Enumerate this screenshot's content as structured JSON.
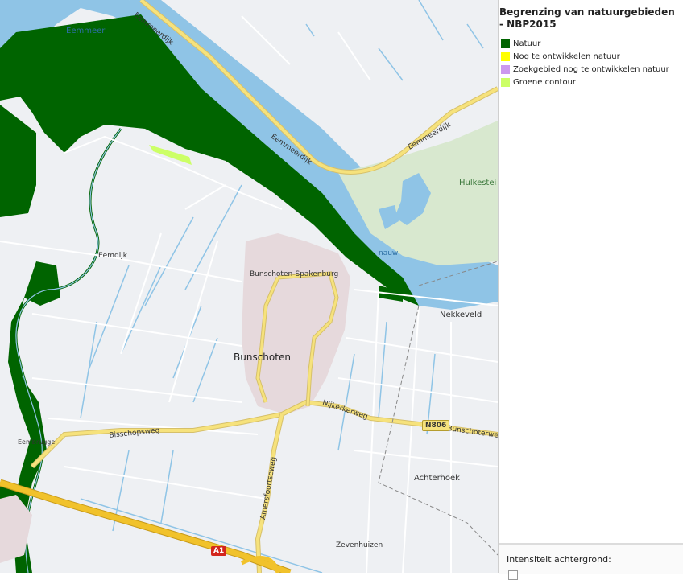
{
  "map": {
    "place_labels": {
      "eemmeer": "Eemmeer",
      "eemmeerdijk_1": "Eemmeerdijk",
      "eemmeerdijk_2": "Eemmeerdijk",
      "eemmeerdijk_3": "Eemmeerdijk",
      "hulkestein": "Hulkestei",
      "nauw": "nauw",
      "nekkeveld": "Nekkeveld",
      "bunschoten_spakenburg": "Bunschoten-Spakenburg",
      "bunschoten": "Bunschoten",
      "eemdijk": "Eemdijk",
      "nijkerkerweg": "Nijkerkerweg",
      "bunschoterweg": "Bunschoterwe",
      "bisschopsweg": "Bisschopsweg",
      "eembrugge": "Eembrugge",
      "amersfoortseweg": "Amersfoortseweg",
      "achterhoek": "Achterhoek",
      "zevenhuizen": "Zevenhuizen"
    },
    "shields": {
      "n806": "N806",
      "a1": "A1"
    },
    "colors": {
      "natuur": "#006400",
      "water": "#8fc4e6",
      "land": "#eef0f3",
      "urban": "#e6d9dc",
      "park": "#d8e8cf",
      "main_road": "#f6e27c",
      "motorway": "#f1c22b"
    }
  },
  "legend": {
    "title": "Begrenzing van natuurgebieden - NBP2015",
    "items": [
      {
        "label": "Natuur",
        "color": "#006400"
      },
      {
        "label": "Nog te ontwikkelen natuur",
        "color": "#ffff00"
      },
      {
        "label": "Zoekgebied nog te ontwikkelen natuur",
        "color": "#cc99ee"
      },
      {
        "label": "Groene contour",
        "color": "#ccff66"
      }
    ]
  },
  "intensity": {
    "label": "Intensiteit achtergrond:"
  }
}
